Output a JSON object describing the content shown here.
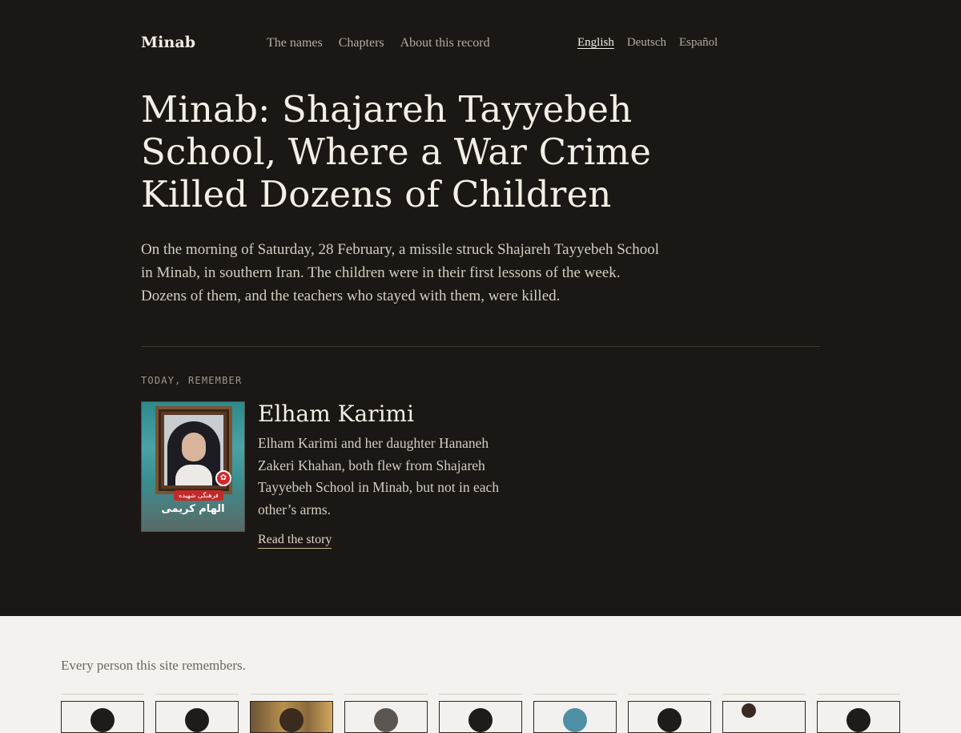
{
  "nav": {
    "brand": "Minab",
    "links": [
      "The names",
      "Chapters",
      "About this record"
    ],
    "languages": [
      "English",
      "Deutsch",
      "Español"
    ],
    "active_language": "English"
  },
  "hero": {
    "title": "Minab: Shajareh Tayyebeh School, Where a War Crime Killed Dozens of Children",
    "intro": "On the morning of Saturday, 28 February, a missile struck Shajareh Tayyebeh School in Minab, in southern Iran. The children were in their first lessons of the week. Dozens of them, and the teachers who stayed with them, were killed."
  },
  "remember": {
    "label": "TODAY, REMEMBER",
    "name": "Elham Karimi",
    "description": "Elham Karimi and her daughter Hananeh Zakeri Khahan, both flew from Shajareh Tayyebeh School in Minab, but not in each other’s arms.",
    "link_label": "Read the story",
    "poster_ribbon": "فرهنگی شهیده",
    "poster_name": "الهام کریمی"
  },
  "list": {
    "heading": "Every person this site remembers."
  },
  "colors": {
    "hero_bg": "#1a1714",
    "lower_bg": "#f4f2ee",
    "accent_link": "#c9b79a"
  }
}
